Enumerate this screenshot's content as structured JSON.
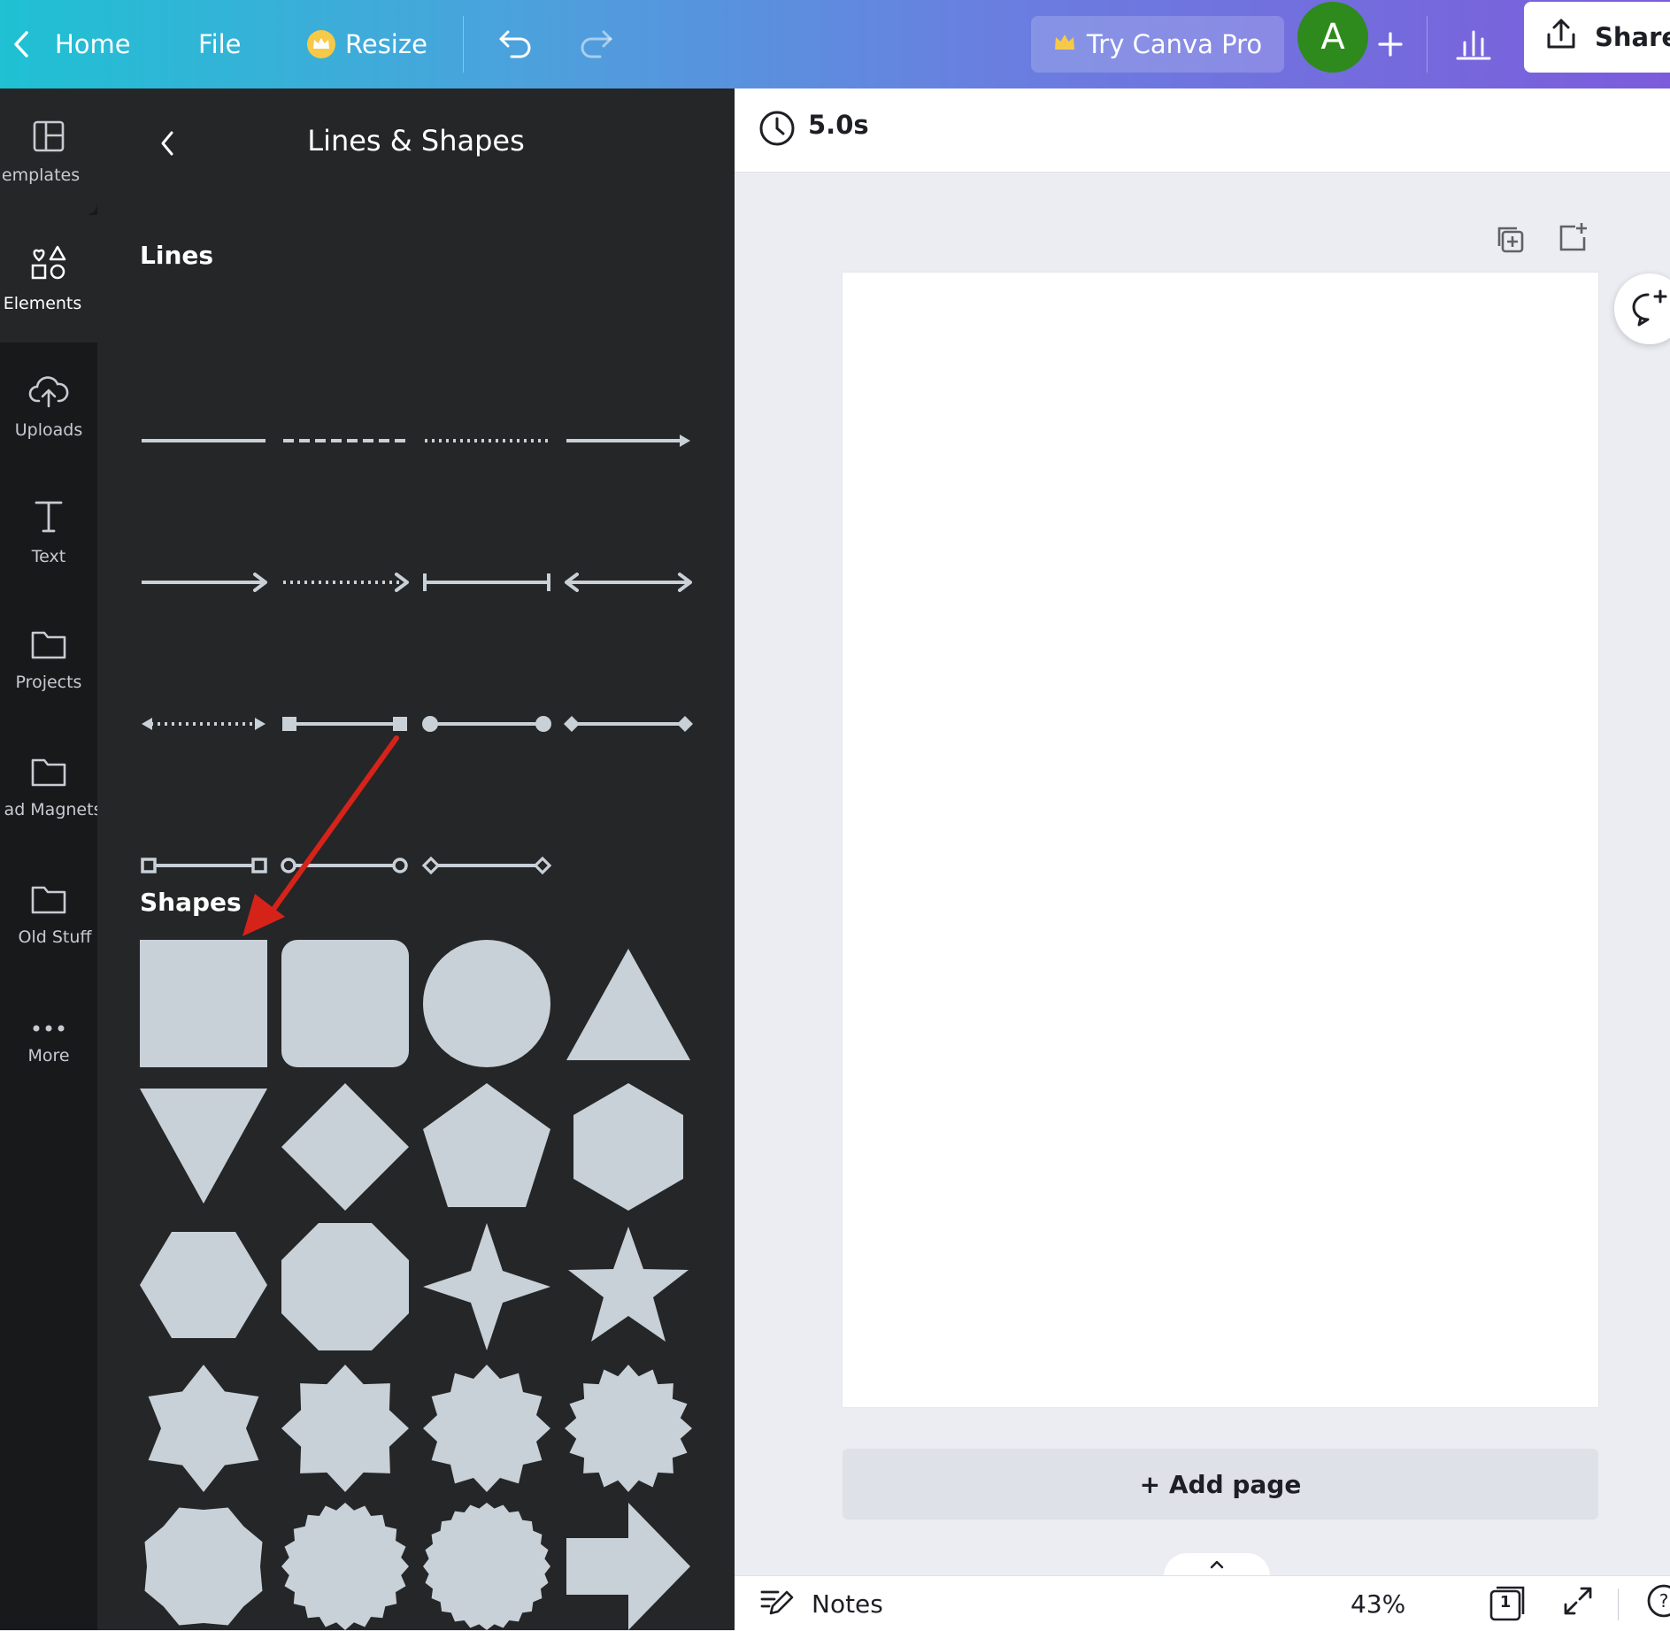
{
  "topbar": {
    "home": "Home",
    "file": "File",
    "resize": "Resize",
    "try_pro": "Try Canva Pro",
    "avatar_letter": "A",
    "share": "Share"
  },
  "rail": {
    "templates": "emplates",
    "elements": "Elements",
    "uploads": "Uploads",
    "text": "Text",
    "projects": "Projects",
    "lead_magnets": "ad Magnets",
    "old_stuff": "Old Stuff",
    "more": "More"
  },
  "panel": {
    "title": "Lines & Shapes",
    "lines_heading": "Lines",
    "shapes_heading": "Shapes"
  },
  "stage": {
    "duration": "5.0s",
    "add_page": "+ Add page",
    "notes": "Notes",
    "zoom": "43%",
    "page_count": "1"
  },
  "colors": {
    "shape_fill": "#c8d0d8",
    "panel_bg": "#252627",
    "rail_bg": "#18191b",
    "arrow_red": "#d6231a"
  }
}
